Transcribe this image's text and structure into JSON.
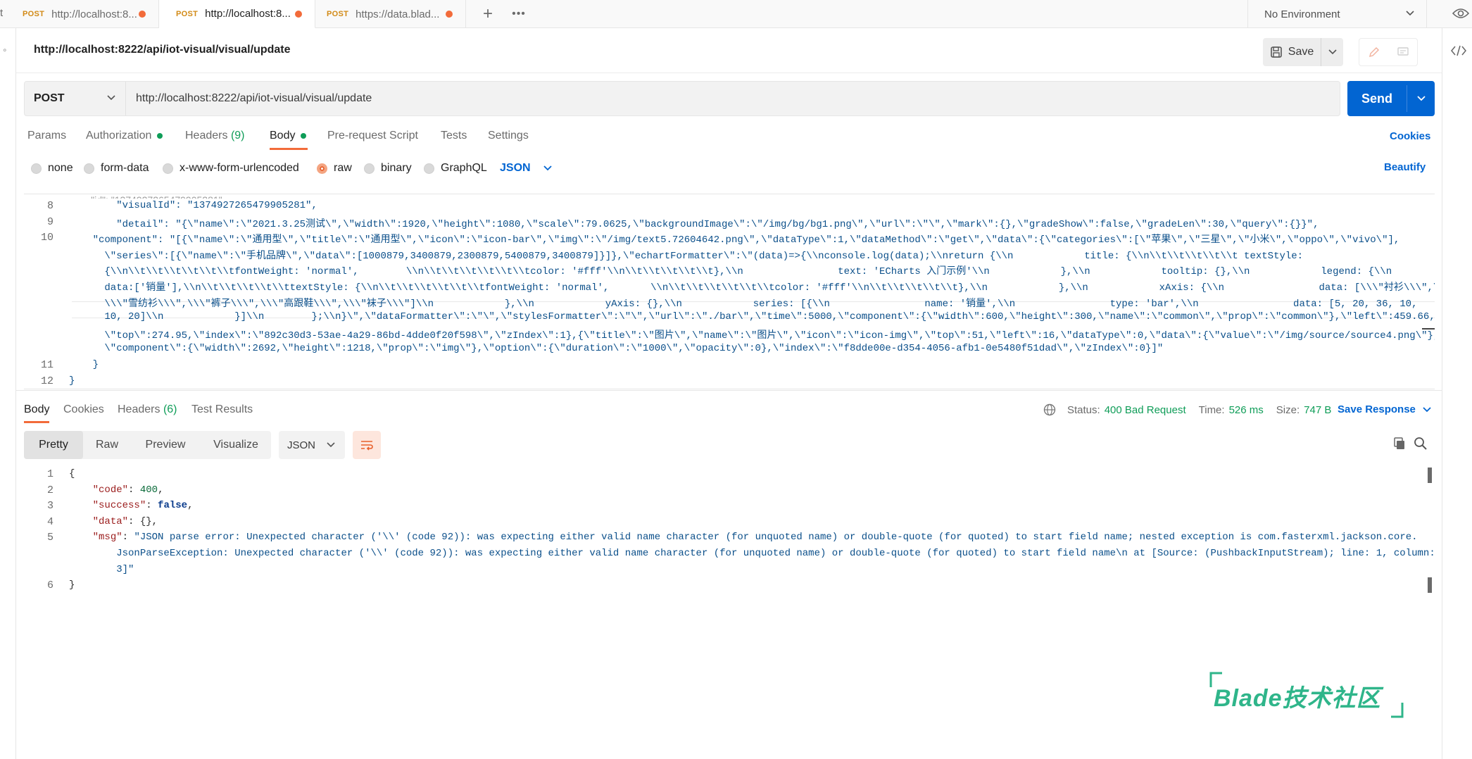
{
  "tabs": [
    {
      "method": "POST",
      "label": "http://localhost:8..."
    },
    {
      "method": "POST",
      "label": "http://localhost:8..."
    },
    {
      "method": "POST",
      "label": "https://data.blad..."
    }
  ],
  "environment": "No Environment",
  "request": {
    "title": "http://localhost:8222/api/iot-visual/visual/update",
    "method": "POST",
    "url": "http://localhost:8222/api/iot-visual/visual/update",
    "save_label": "Save",
    "send_label": "Send"
  },
  "request_tabs": [
    {
      "label": "Params"
    },
    {
      "label": "Authorization"
    },
    {
      "label": "Headers",
      "count": "(9)"
    },
    {
      "label": "Body"
    },
    {
      "label": "Pre-request Script"
    },
    {
      "label": "Tests"
    },
    {
      "label": "Settings"
    }
  ],
  "cookies_link": "Cookies",
  "body_modes": [
    "none",
    "form-data",
    "x-www-form-urlencoded",
    "raw",
    "binary",
    "GraphQL"
  ],
  "body_format": "JSON",
  "beautify_label": "Beautify",
  "request_body_lines": [
    {
      "n": "8",
      "text": "        \"visualId\": \"1374927265479905281\","
    },
    {
      "n": "9",
      "text": "        \"detail\": \"{\\\"name\\\":\\\"2021.3.25测试\\\",\\\"width\\\":1920,\\\"height\\\":1080,\\\"scale\\\":79.0625,\\\"backgroundImage\\\":\\\"/img/bg/bg1.png\\\",\\\"url\\\":\\\"\\\",\\\"mark\\\":{},\\\"gradeShow\\\":false,\\\"gradeLen\\\":30,\\\"query\\\":{}}\","
    },
    {
      "n": "10",
      "text": "    \"component\": \"[{\\\"name\\\":\\\"通用型\\\",\\\"title\\\":\\\"通用型\\\",\\\"icon\\\":\\\"icon-bar\\\",\\\"img\\\":\\\"/img/text5.72604642.png\\\",\\\"dataType\\\":1,\\\"dataMethod\\\":\\\"get\\\",\\\"data\\\":{\\\"categories\\\":[\\\"苹果\\\",\\\"三星\\\",\\\"小米\\\",\\\"oppo\\\",\\\"vivo\\\"],"
    },
    {
      "n": "",
      "text": "      \\\"series\\\":[{\\\"name\\\":\\\"手机品牌\\\",\\\"data\\\":[1000879,3400879,2300879,5400879,3400879]}]},\\\"echartFormatter\\\":\\\"(data)=>{\\\\nconsole.log(data);\\\\nreturn {\\\\n            title: {\\\\n\\\\t\\\\t\\\\t\\\\t\\\\t textStyle:"
    },
    {
      "n": "",
      "text": "      {\\\\n\\\\t\\\\t\\\\t\\\\t\\\\t\\\\tfontWeight: 'normal',        \\\\n\\\\t\\\\t\\\\t\\\\t\\\\t\\\\tcolor: '#fff'\\\\n\\\\t\\\\t\\\\t\\\\t\\\\t},\\\\n                text: 'ECharts 入门示例'\\\\n            },\\\\n            tooltip: {},\\\\n            legend: {\\\\n"
    },
    {
      "n": "",
      "text": "      data:['销量'],\\\\n\\\\t\\\\t\\\\t\\\\t\\\\ttextStyle: {\\\\n\\\\t\\\\t\\\\t\\\\t\\\\t\\\\tfontWeight: 'normal',       \\\\n\\\\t\\\\t\\\\t\\\\t\\\\t\\\\tcolor: '#fff'\\\\n\\\\t\\\\t\\\\t\\\\t\\\\t},\\\\n            },\\\\n            xAxis: {\\\\n                data: [\\\\\\\"衬衫\\\\\\\",\\\\\\\"羊毛衫\\\\\\\","
    },
    {
      "n": "",
      "text": "      \\\\\\\"雪纺衫\\\\\\\",\\\\\\\"裤子\\\\\\\",\\\\\\\"高跟鞋\\\\\\\",\\\\\\\"袜子\\\\\\\"]\\\\n            },\\\\n            yAxis: {},\\\\n            series: [{\\\\n                name: '销量',\\\\n                type: 'bar',\\\\n                data: [5, 20, 36, 10,"
    },
    {
      "n": "",
      "text": "      10, 20]\\\\n            }]\\\\n        };\\\\n}\\\",\\\"dataFormatter\\\":\\\"\\\",\\\"stylesFormatter\\\":\\\"\\\",\\\"url\\\":\\\"./bar\\\",\\\"time\\\":5000,\\\"component\\\":{\\\"width\\\":600,\\\"height\\\":300,\\\"name\\\":\\\"common\\\",\\\"prop\\\":\\\"common\\\"},\\\"left\\\":459.66,"
    },
    {
      "n": "",
      "text": "      \\\"top\\\":274.95,\\\"index\\\":\\\"892c30d3-53ae-4a29-86bd-4dde0f20f598\\\",\\\"zIndex\\\":1},{\\\"title\\\":\\\"图片\\\",\\\"name\\\":\\\"图片\\\",\\\"icon\\\":\\\"icon-img\\\",\\\"top\\\":51,\\\"left\\\":16,\\\"dataType\\\":0,\\\"data\\\":{\\\"value\\\":\\\"/img/source/source4.png\\\"},"
    },
    {
      "n": "",
      "text": "      \\\"component\\\":{\\\"width\\\":2692,\\\"height\\\":1218,\\\"prop\\\":\\\"img\\\"},\\\"option\\\":{\\\"duration\\\":\\\"1000\\\",\\\"opacity\\\":0},\\\"index\\\":\\\"f8dde00e-d354-4056-afb1-0e5480f51dad\\\",\\\"zIndex\\\":0}]\""
    },
    {
      "n": "11",
      "text": "    }"
    },
    {
      "n": "12",
      "text": "}"
    }
  ],
  "response_tabs": [
    {
      "label": "Body"
    },
    {
      "label": "Cookies"
    },
    {
      "label": "Headers",
      "count": "(6)"
    },
    {
      "label": "Test Results"
    }
  ],
  "response_status": {
    "status_label": "Status:",
    "status_value": "400 Bad Request",
    "time_label": "Time:",
    "time_value": "526 ms",
    "size_label": "Size:",
    "size_value": "747 B",
    "save_response": "Save Response"
  },
  "view_modes": [
    "Pretty",
    "Raw",
    "Preview",
    "Visualize"
  ],
  "response_format": "JSON",
  "response_lines": [
    {
      "n": "1",
      "text": "{"
    },
    {
      "n": "2",
      "key": "\"code\"",
      "sep": ": ",
      "val": "400",
      "type": "num",
      "tail": ","
    },
    {
      "n": "3",
      "key": "\"success\"",
      "sep": ": ",
      "val": "false",
      "type": "bool",
      "tail": ","
    },
    {
      "n": "4",
      "key": "\"data\"",
      "sep": ": ",
      "val": "{}",
      "type": "plain",
      "tail": ","
    },
    {
      "n": "5",
      "key": "\"msg\"",
      "sep": ": ",
      "val": "\"JSON parse error: Unexpected character ('\\\\' (code 92)): was expecting either valid name character (for unquoted name) or double-quote (for quoted) to start field name; nested exception is com.fasterxml.jackson.core.",
      "type": "str",
      "tail": ""
    },
    {
      "n": "",
      "cont": "    JsonParseException: Unexpected character ('\\\\' (code 92)): was expecting either valid name character (for unquoted name) or double-quote (for quoted) to start field name\\n at [Source: (PushbackInputStream); line: 1, column:"
    },
    {
      "n": "",
      "cont": "    3]\""
    },
    {
      "n": "6",
      "text": "}"
    }
  ],
  "watermark": "Blade技术社区",
  "colors": {
    "accent": "#0265d2",
    "status_green": "#0f9d58",
    "tab_dot": "#f26b3a",
    "method": "#d28a16"
  }
}
